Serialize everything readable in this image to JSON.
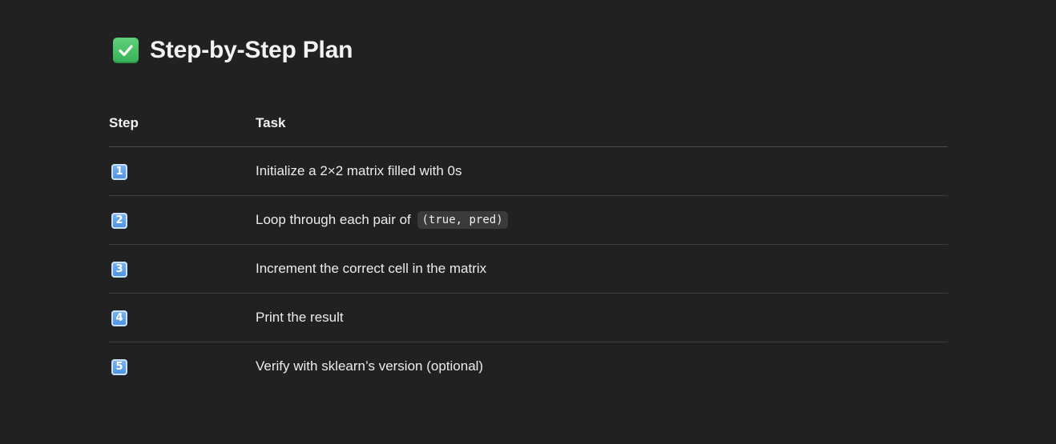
{
  "heading": {
    "icon": "white-check-mark-icon",
    "title": "Step-by-Step Plan"
  },
  "table": {
    "headers": [
      "Step",
      "Task"
    ],
    "rows": [
      {
        "step": "1",
        "step_icon": "keycap-1-icon",
        "task": "Initialize a 2×2 matrix filled with 0s",
        "code": ""
      },
      {
        "step": "2",
        "step_icon": "keycap-2-icon",
        "task": "Loop through each pair of",
        "code": "(true, pred)"
      },
      {
        "step": "3",
        "step_icon": "keycap-3-icon",
        "task": "Increment the correct cell in the matrix",
        "code": ""
      },
      {
        "step": "4",
        "step_icon": "keycap-4-icon",
        "task": "Print the result",
        "code": ""
      },
      {
        "step": "5",
        "step_icon": "keycap-5-icon",
        "task": "Verify with sklearn’s version (optional)",
        "code": ""
      }
    ]
  },
  "colors": {
    "background": "#212121",
    "text": "#ececec",
    "check_green": "#36b257",
    "keycap_blue": "#4a8fe0",
    "code_bg": "#3a3a3a"
  }
}
